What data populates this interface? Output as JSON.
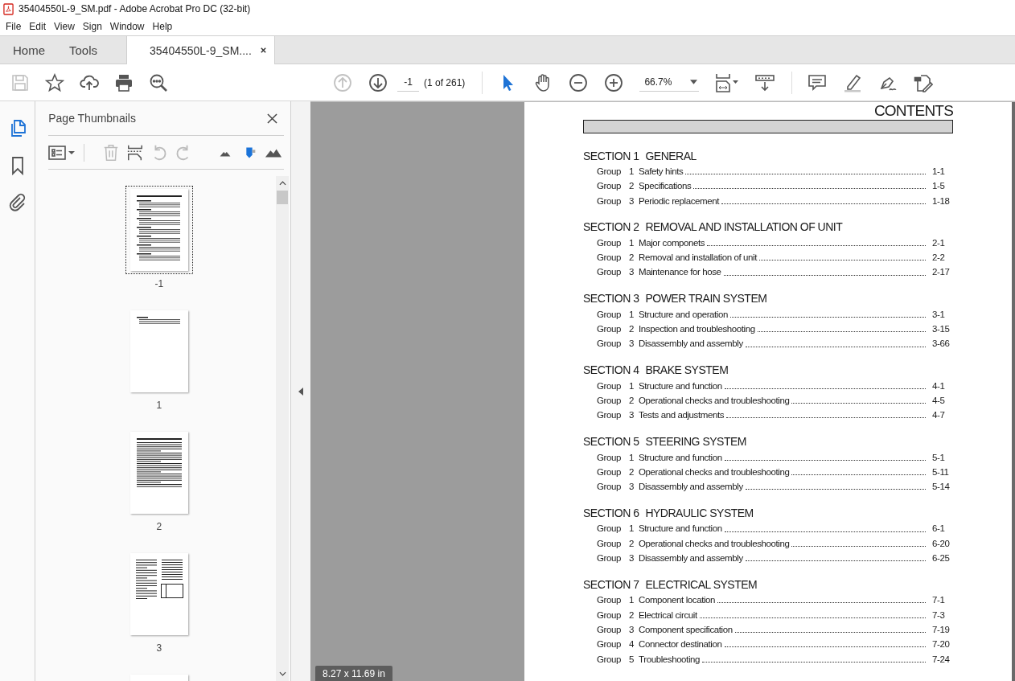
{
  "window": {
    "title": "35404550L-9_SM.pdf - Adobe Acrobat Pro DC (32-bit)"
  },
  "menu": [
    "File",
    "Edit",
    "View",
    "Sign",
    "Window",
    "Help"
  ],
  "tabs": [
    {
      "label": "Home",
      "selected": false,
      "closable": false
    },
    {
      "label": "Tools",
      "selected": false,
      "closable": false
    },
    {
      "label": "35404550L-9_SM....",
      "selected": true,
      "closable": true
    }
  ],
  "toolbar": {
    "left": [
      {
        "kind": "save",
        "disabled": true
      },
      {
        "kind": "star",
        "disabled": false
      },
      {
        "kind": "upload",
        "disabled": false
      },
      {
        "kind": "print",
        "disabled": false
      },
      {
        "kind": "search",
        "disabled": false
      }
    ],
    "nav": [
      {
        "kind": "up",
        "disabled": true
      },
      {
        "kind": "down",
        "disabled": false
      }
    ],
    "page_field": "-1",
    "page_count": "(1 of 261)",
    "tools": [
      {
        "kind": "cursor",
        "selected": true
      },
      {
        "kind": "hand",
        "selected": false
      },
      {
        "kind": "zoom-out",
        "selected": false
      },
      {
        "kind": "zoom-in",
        "selected": false
      }
    ],
    "zoom": "66.7%",
    "right": [
      {
        "kind": "comment"
      },
      {
        "kind": "highlight"
      },
      {
        "kind": "sign"
      },
      {
        "kind": "edit"
      }
    ]
  },
  "rail": [
    {
      "kind": "pages",
      "selected": true
    },
    {
      "kind": "bookmark",
      "selected": false
    },
    {
      "kind": "attachment",
      "selected": false
    }
  ],
  "panel": {
    "title": "Page Thumbnails",
    "tools": [
      {
        "kind": "options",
        "disabled": false
      },
      {
        "kind": "delete",
        "disabled": true
      },
      {
        "kind": "insert",
        "disabled": false
      },
      {
        "kind": "rotate-left",
        "disabled": true
      },
      {
        "kind": "rotate-right",
        "disabled": true
      },
      {
        "kind": "smaller",
        "disabled": false
      },
      {
        "kind": "slider",
        "disabled": false
      },
      {
        "kind": "larger",
        "disabled": false
      }
    ],
    "thumbnails": [
      {
        "label": "-1",
        "kind": "toc",
        "selected": true
      },
      {
        "label": "1",
        "kind": "short",
        "selected": false
      },
      {
        "label": "2",
        "kind": "text",
        "selected": false
      },
      {
        "label": "3",
        "kind": "columns",
        "selected": false
      },
      {
        "kind": "blank",
        "selected": false
      }
    ]
  },
  "page_size": "8.27 x 11.69 in",
  "document": {
    "title": "CONTENTS",
    "sections": [
      {
        "number": "SECTION 1",
        "title": "GENERAL",
        "groups": [
          {
            "label": "Group",
            "number": "1",
            "title": "Safety hints",
            "page": "1-1"
          },
          {
            "label": "Group",
            "number": "2",
            "title": "Specifications",
            "page": "1-5"
          },
          {
            "label": "Group",
            "number": "3",
            "title": "Periodic replacement",
            "page": "1-18"
          }
        ]
      },
      {
        "number": "SECTION 2",
        "title": "REMOVAL AND INSTALLATION OF UNIT",
        "groups": [
          {
            "label": "Group",
            "number": "1",
            "title": "Major componets",
            "page": "2-1"
          },
          {
            "label": "Group",
            "number": "2",
            "title": "Removal and installation of unit",
            "page": "2-2"
          },
          {
            "label": "Group",
            "number": "3",
            "title": "Maintenance for hose",
            "page": "2-17"
          }
        ]
      },
      {
        "number": "SECTION 3",
        "title": "POWER TRAIN SYSTEM",
        "groups": [
          {
            "label": "Group",
            "number": "1",
            "title": "Structure and operation",
            "page": "3-1"
          },
          {
            "label": "Group",
            "number": "2",
            "title": "Inspection and troubleshooting",
            "page": "3-15"
          },
          {
            "label": "Group",
            "number": "3",
            "title": "Disassembly and assembly",
            "page": "3-66"
          }
        ]
      },
      {
        "number": "SECTION 4",
        "title": "BRAKE SYSTEM",
        "groups": [
          {
            "label": "Group",
            "number": "1",
            "title": "Structure and function",
            "page": "4-1"
          },
          {
            "label": "Group",
            "number": "2",
            "title": "Operational checks and troubleshooting",
            "page": "4-5"
          },
          {
            "label": "Group",
            "number": "3",
            "title": "Tests and adjustments",
            "page": "4-7"
          }
        ]
      },
      {
        "number": "SECTION 5",
        "title": "STEERING SYSTEM",
        "groups": [
          {
            "label": "Group",
            "number": "1",
            "title": "Structure and function",
            "page": "5-1"
          },
          {
            "label": "Group",
            "number": "2",
            "title": "Operational checks and troubleshooting",
            "page": "5-11"
          },
          {
            "label": "Group",
            "number": "3",
            "title": "Disassembly and assembly",
            "page": "5-14"
          }
        ]
      },
      {
        "number": "SECTION 6",
        "title": "HYDRAULIC SYSTEM",
        "groups": [
          {
            "label": "Group",
            "number": "1",
            "title": "Structure and function",
            "page": "6-1"
          },
          {
            "label": "Group",
            "number": "2",
            "title": "Operational checks and troubleshooting",
            "page": "6-20"
          },
          {
            "label": "Group",
            "number": "3",
            "title": "Disassembly and assembly",
            "page": "6-25"
          }
        ]
      },
      {
        "number": "SECTION 7",
        "title": "ELECTRICAL SYSTEM",
        "groups": [
          {
            "label": "Group",
            "number": "1",
            "title": "Component location",
            "page": "7-1"
          },
          {
            "label": "Group",
            "number": "2",
            "title": "Electrical circuit",
            "page": "7-3"
          },
          {
            "label": "Group",
            "number": "3",
            "title": "Component specification",
            "page": "7-19"
          },
          {
            "label": "Group",
            "number": "4",
            "title": "Connector destination",
            "page": "7-20"
          },
          {
            "label": "Group",
            "number": "5",
            "title": "Troubleshooting",
            "page": "7-24"
          }
        ]
      }
    ]
  }
}
